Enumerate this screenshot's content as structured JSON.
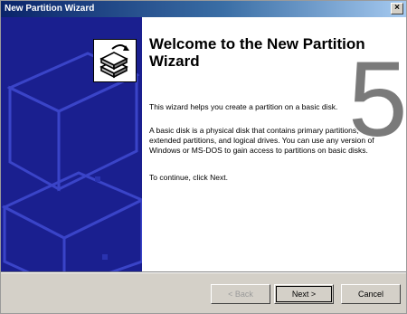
{
  "window": {
    "title": "New Partition Wizard",
    "close_glyph": "×"
  },
  "main": {
    "heading": "Welcome to the New Partition Wizard",
    "paragraph_1": "This wizard helps you create a partition on a basic disk.",
    "paragraph_2": "A basic disk is a physical disk that contains primary partitions, extended partitions, and logical drives. You can use any version of Windows or MS-DOS to gain access to partitions on basic disks.",
    "paragraph_3": "To continue, click Next.",
    "overlay_number": "5"
  },
  "buttons": {
    "back": "< Back",
    "next": "Next >",
    "cancel": "Cancel"
  },
  "colors": {
    "side_panel": "#1a1f8f",
    "titlebar_start": "#0a246a",
    "titlebar_end": "#a6caf0"
  }
}
